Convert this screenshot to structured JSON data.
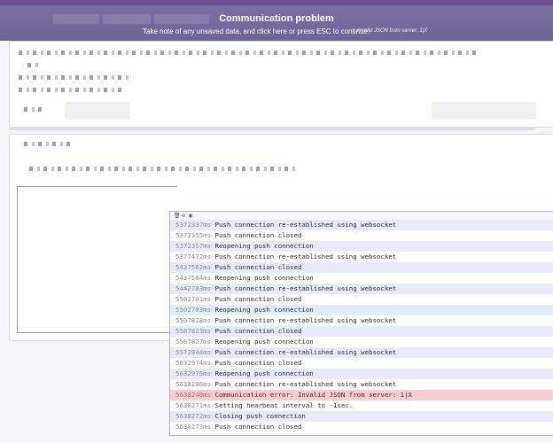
{
  "banner": {
    "title": "Communication problem",
    "message": "Take note of any unsaved data, and click here or press ESC to continue.",
    "detail": "Invalid JSON from server: 1|X"
  },
  "console": {
    "toolbar_icons": [
      "trash-icon",
      "settings-icon",
      "lock-icon"
    ],
    "log": [
      {
        "time": "5372337ms",
        "text": "Push connection re-established using websocket"
      },
      {
        "time": "5372355ms",
        "text": "Push connection closed"
      },
      {
        "time": "5372357ms",
        "text": "Reopening push connection"
      },
      {
        "time": "5377472ms",
        "text": "Push connection re-established using websocket"
      },
      {
        "time": "5437582ms",
        "text": "Push connection closed"
      },
      {
        "time": "5437584ms",
        "text": "Reopening push connection"
      },
      {
        "time": "5442703ms",
        "text": "Push connection re-established using websocket"
      },
      {
        "time": "5502701ms",
        "text": "Push connection closed"
      },
      {
        "time": "5502703ms",
        "text": "Reopening push connection"
      },
      {
        "time": "5507828ms",
        "text": "Push connection re-established using websocket"
      },
      {
        "time": "5567823ms",
        "text": "Push connection closed"
      },
      {
        "time": "5567827ms",
        "text": "Reopening push connection"
      },
      {
        "time": "5572944ms",
        "text": "Push connection re-established using websocket"
      },
      {
        "time": "5632974ms",
        "text": "Push connection closed"
      },
      {
        "time": "5632976ms",
        "text": "Reopening push connection"
      },
      {
        "time": "5638206ms",
        "text": "Push connection re-established using websocket"
      },
      {
        "time": "5638240ms",
        "text": "Communication error: Invalid JSON from server: 1|X",
        "level": "error"
      },
      {
        "time": "5638271ms",
        "text": "Setting hearbeat interval to -1sec."
      },
      {
        "time": "5638272ms",
        "text": "Closing push connection"
      },
      {
        "time": "5638273ms",
        "text": "Push connection closed"
      }
    ]
  },
  "colors": {
    "banner_bg": "#7568a0",
    "error_row": "#f6cdd0",
    "stripe_row": "#e7eaf9"
  }
}
